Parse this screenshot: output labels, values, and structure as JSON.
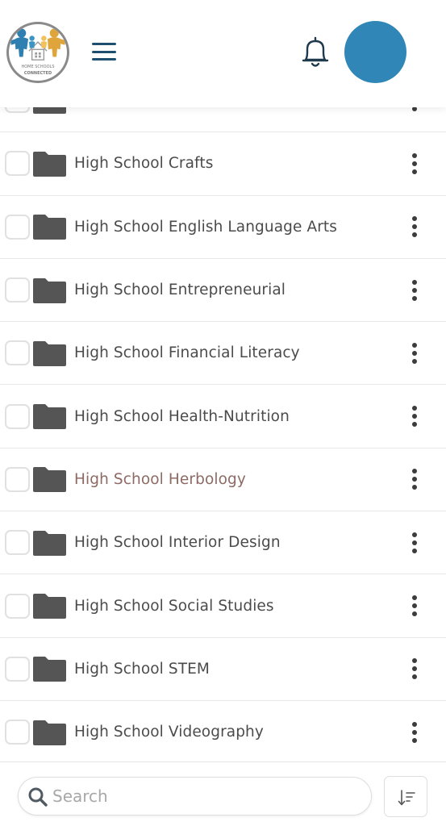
{
  "header": {
    "logo_line1": "HOME SCHOOLS",
    "logo_line2": "CONNECTED",
    "colors": {
      "menu": "#1f4f6e",
      "avatar": "#2f86b7"
    }
  },
  "folders": [
    {
      "label": "",
      "visited": false
    },
    {
      "label": "High School Crafts",
      "visited": false
    },
    {
      "label": "High School English Language Arts",
      "visited": false
    },
    {
      "label": "High School Entrepreneurial",
      "visited": false
    },
    {
      "label": "High School Financial Literacy",
      "visited": false
    },
    {
      "label": "High School Health-Nutrition",
      "visited": false
    },
    {
      "label": "High School Herbology",
      "visited": true
    },
    {
      "label": "High School Interior Design",
      "visited": false
    },
    {
      "label": "High School Social Studies",
      "visited": false
    },
    {
      "label": "High School STEM",
      "visited": false
    },
    {
      "label": "High School Videography",
      "visited": false
    }
  ],
  "search": {
    "placeholder": "Search",
    "value": ""
  },
  "icons": {
    "menu": "hamburger-menu-icon",
    "bell": "bell-icon",
    "folder": "folder-icon",
    "more": "more-vertical-icon",
    "search": "search-icon",
    "sort": "sort-icon"
  }
}
